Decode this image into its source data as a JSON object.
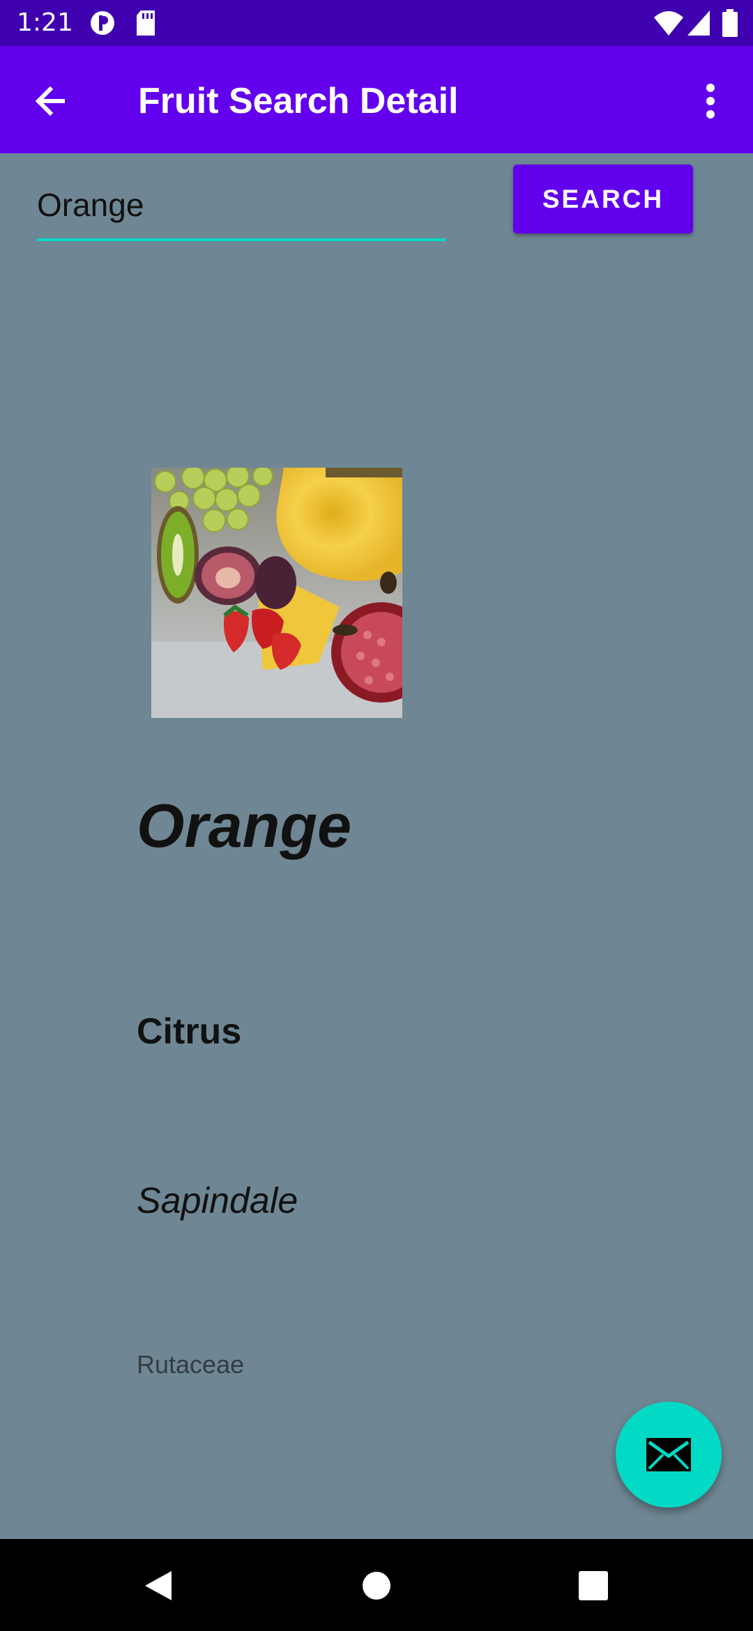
{
  "status_bar": {
    "time": "1:21",
    "icons": [
      "notification-app-icon",
      "sd-card-icon",
      "wifi-icon",
      "signal-icon",
      "battery-icon"
    ]
  },
  "app_bar": {
    "title": "Fruit Search Detail",
    "back_icon": "arrow-left-icon",
    "menu_icon": "more-vertical-icon"
  },
  "search": {
    "value": "Orange",
    "button_label": "SEARCH"
  },
  "fruit": {
    "image": "mixed-fruit-photo",
    "name": "Orange",
    "genus": "Citrus",
    "order": "Sapindale",
    "family": "Rutaceae"
  },
  "fab": {
    "icon": "mail-icon"
  },
  "nav_bar": {
    "icons": [
      "back-triangle-icon",
      "home-circle-icon",
      "recents-square-icon"
    ]
  },
  "colors": {
    "status_bar": "#3f00b0",
    "app_bar": "#6200ee",
    "accent": "#03dac5",
    "background": "#6f8794"
  }
}
